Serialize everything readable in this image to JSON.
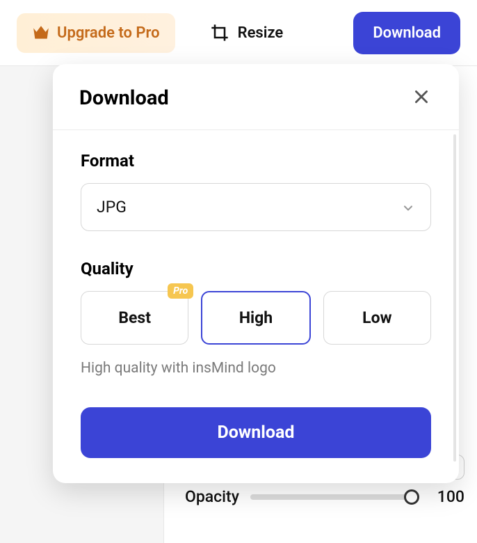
{
  "topbar": {
    "upgrade_label": "Upgrade to Pro",
    "resize_label": "Resize",
    "download_label": "Download"
  },
  "modal": {
    "title": "Download",
    "format_label": "Format",
    "format_value": "JPG",
    "quality_label": "Quality",
    "quality_options": {
      "best": "Best",
      "high": "High",
      "low": "Low"
    },
    "pro_badge": "Pro",
    "quality_hint": "High quality with insMind logo",
    "cta_label": "Download"
  },
  "right_panel": {
    "opacity_label": "Opacity",
    "opacity_value": "100"
  }
}
